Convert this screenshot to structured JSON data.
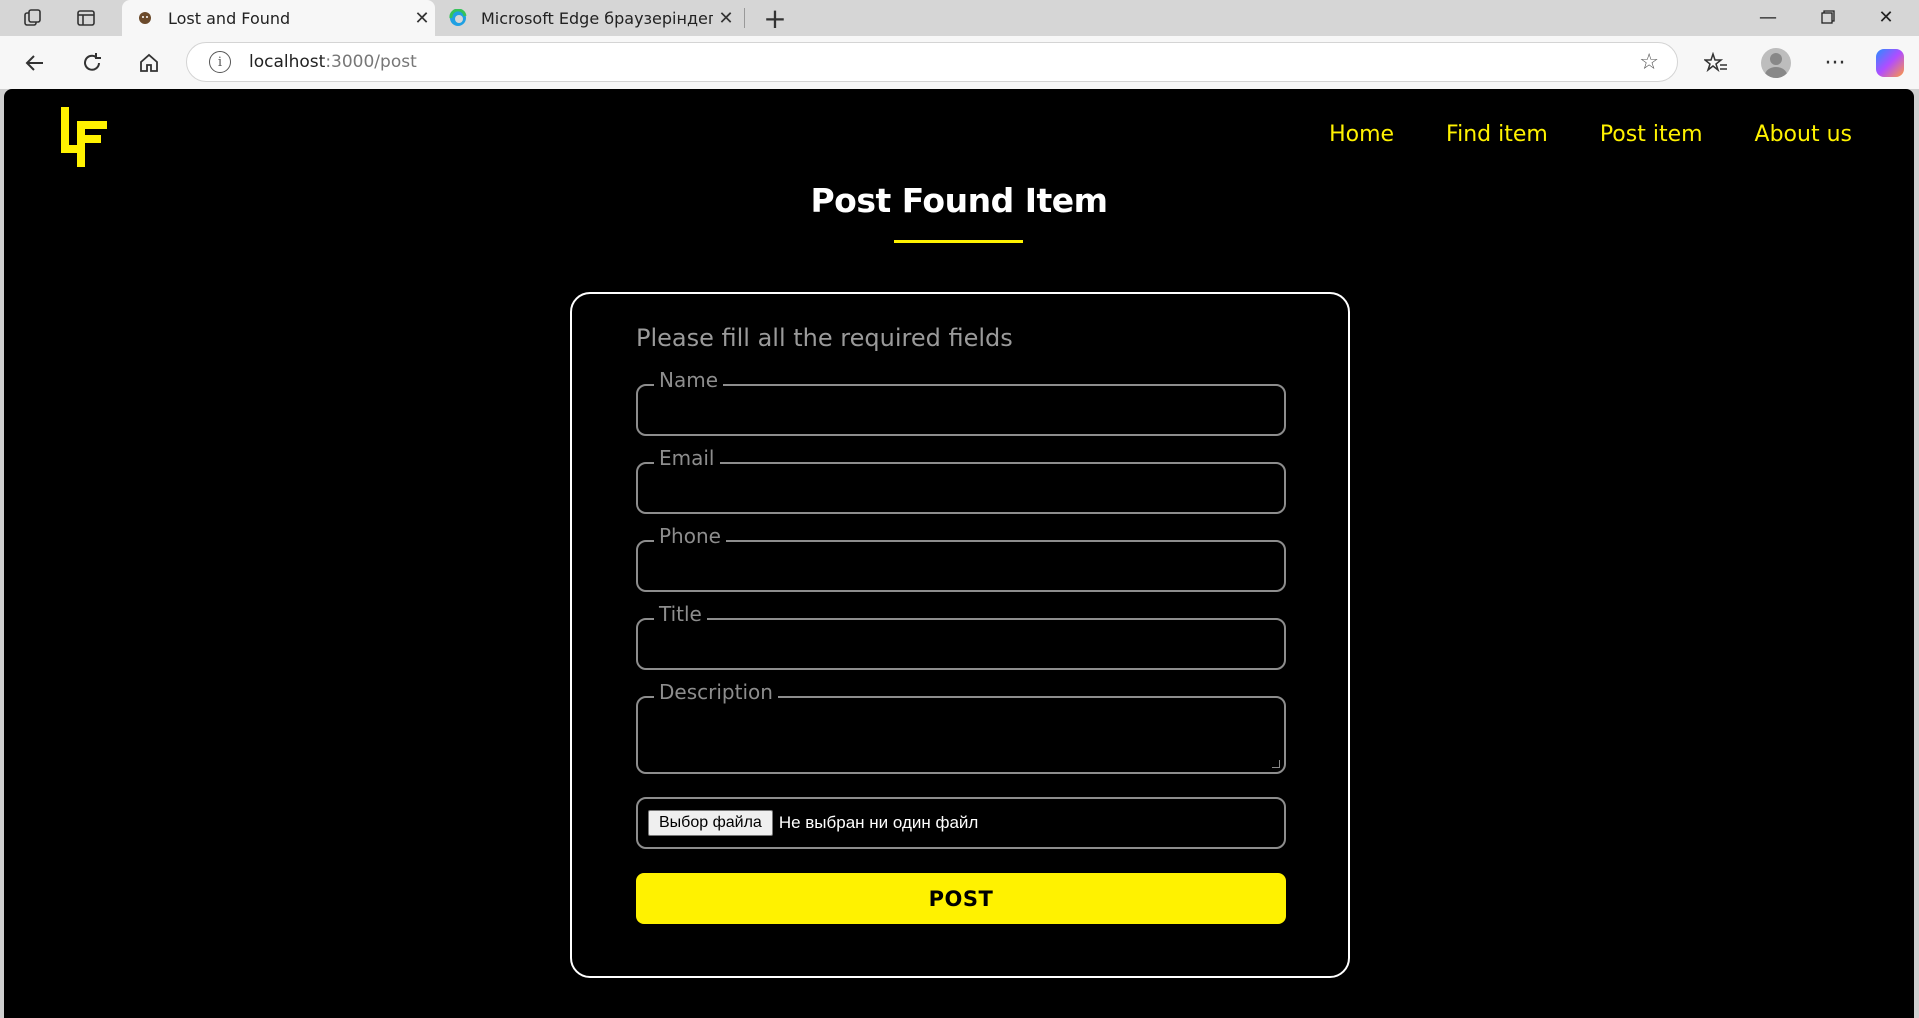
{
  "browser": {
    "tabs": [
      {
        "title": "Lost and Found",
        "active": true
      },
      {
        "title": "Microsoft Edge браузеріндегі жа",
        "active": false
      }
    ],
    "address": {
      "host": "localhost",
      "path": ":3000/post"
    }
  },
  "nav": {
    "items": [
      "Home",
      "Find item",
      "Post item",
      "About us"
    ]
  },
  "page": {
    "title": "Post Found Item",
    "hint": "Please fill all the required fields",
    "fields": {
      "name": "Name",
      "email": "Email",
      "phone": "Phone",
      "title": "Title",
      "description": "Description"
    },
    "file": {
      "button": "Выбор файла",
      "status": "Не выбран ни один файл"
    },
    "submit": "POST"
  },
  "colors": {
    "accent": "#fff200",
    "background": "#000000",
    "field_border": "#8d8d8d"
  }
}
